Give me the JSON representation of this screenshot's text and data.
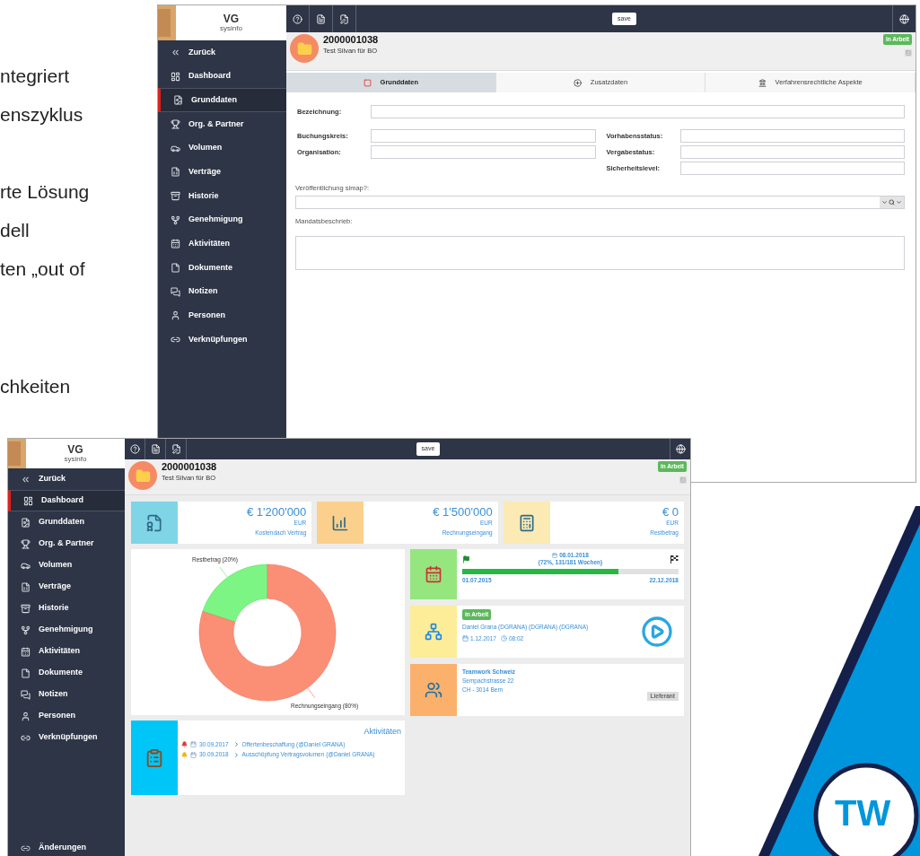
{
  "slide_text": [
    "ntegriert",
    "enszyklus",
    "rte Lösung",
    "dell",
    "ten „out of",
    "chkeiten"
  ],
  "back_window": {
    "logo": {
      "title": "VG",
      "subtitle": "sysinfo"
    },
    "sidebar": {
      "items": [
        {
          "label": "Zurück",
          "selected": false
        },
        {
          "label": "Dashboard",
          "selected": false
        },
        {
          "label": "Grunddaten",
          "selected": true
        },
        {
          "label": "Org. & Partner",
          "selected": false
        },
        {
          "label": "Volumen",
          "selected": false
        },
        {
          "label": "Verträge",
          "selected": false
        },
        {
          "label": "Historie",
          "selected": false
        },
        {
          "label": "Genehmigung",
          "selected": false
        },
        {
          "label": "Aktivitäten",
          "selected": false
        },
        {
          "label": "Dokumente",
          "selected": false
        },
        {
          "label": "Notizen",
          "selected": false
        },
        {
          "label": "Personen",
          "selected": false
        },
        {
          "label": "Verknüpfungen",
          "selected": false
        }
      ]
    },
    "toolbar": {
      "save_button": "save"
    },
    "header": {
      "number": "2000001038",
      "subtitle": "Test Silvan für BO",
      "status": "in Arbeit"
    },
    "tabs": [
      {
        "label": "Grunddaten",
        "selected": true
      },
      {
        "label": "Zusatzdaten",
        "selected": false
      },
      {
        "label": "Verfahrensrechtliche Aspekte",
        "selected": false
      }
    ],
    "form": {
      "bezeichnung": "Bezeichnung:",
      "left_fields": [
        "Buchungskreis:",
        "Organisation:"
      ],
      "right_fields": [
        "Vorhabensstatus:",
        "Vergabestatus:",
        "Sicherheitslevel:"
      ],
      "simap": "Veröffentlichung simap?:",
      "mandat": "Mandatsbeschrieb:"
    }
  },
  "front_window": {
    "logo": {
      "title": "VG",
      "subtitle": "sysinfo"
    },
    "sidebar": {
      "items": [
        {
          "label": "Zurück",
          "selected": false
        },
        {
          "label": "Dashboard",
          "selected": true
        },
        {
          "label": "Grunddaten",
          "selected": false
        },
        {
          "label": "Org. & Partner",
          "selected": false
        },
        {
          "label": "Volumen",
          "selected": false
        },
        {
          "label": "Verträge",
          "selected": false
        },
        {
          "label": "Historie",
          "selected": false
        },
        {
          "label": "Genehmigung",
          "selected": false
        },
        {
          "label": "Aktivitäten",
          "selected": false
        },
        {
          "label": "Dokumente",
          "selected": false
        },
        {
          "label": "Notizen",
          "selected": false
        },
        {
          "label": "Personen",
          "selected": false
        },
        {
          "label": "Verknüpfungen",
          "selected": false
        }
      ],
      "footer_item": "Änderungen"
    },
    "toolbar": {
      "save_button": "save"
    },
    "header": {
      "number": "2000001038",
      "subtitle": "Test Silvan für BO",
      "status": "in Arbeit"
    },
    "kpis": [
      {
        "value": "€ 1'200'000",
        "currency": "EUR",
        "label": "Kostendach Vertrag"
      },
      {
        "value": "€ 1'500'000",
        "currency": "EUR",
        "label": "Rechnungseingang"
      },
      {
        "value": "€ 0",
        "currency": "EUR",
        "label": "Restbetrag"
      }
    ],
    "chart": {
      "chart_data": {
        "type": "donut",
        "categories": [
          "Restbetrag (20%)",
          "Rechnungseingang (80%)"
        ],
        "values": [
          20,
          80
        ]
      }
    },
    "timeline": {
      "current_date": "08.01.2018",
      "progress_text": "(72%, 131/181 Wochen)",
      "level": 0.72,
      "start": "01.07.2015",
      "end": "22.12.2018"
    },
    "status": {
      "badge": "in Arbeit",
      "person": "Daniel Grana (DGRANA) (DGRANA) (DGRANA)",
      "date": "1.12.2017",
      "time": "08:02"
    },
    "partner": {
      "name": "Teamwork Schweiz",
      "street": "Sempachstrasse 22",
      "city": "CH - 3014 Bern",
      "role": "Lieferant"
    },
    "activities": {
      "title": "Aktivitäten",
      "items": [
        {
          "color": "#e53935",
          "date": "30.09.2017",
          "text": "Offertenbeschaffung (@Daniel GRANA)"
        },
        {
          "color": "#f5b400",
          "date": "30.09.2018",
          "text": "Ausschöpfung Vertragsvolumen (@Daniel GRANA)"
        }
      ]
    }
  },
  "logo": {
    "text": "TW"
  }
}
